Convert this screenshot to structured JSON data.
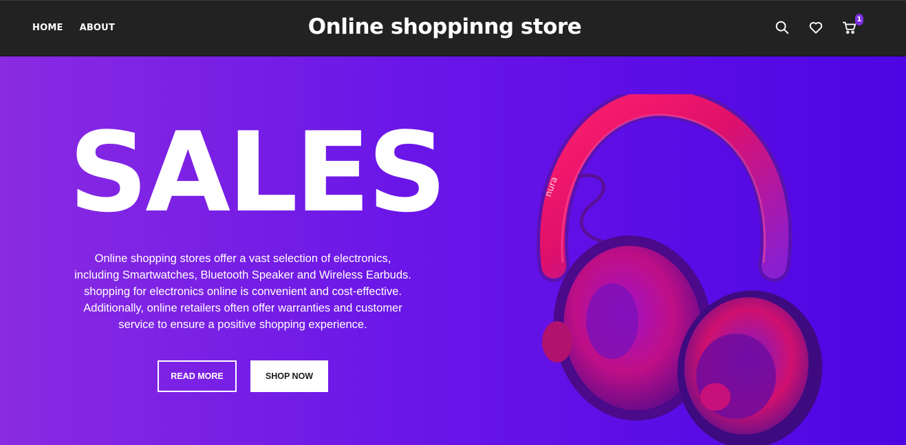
{
  "nav": {
    "links": [
      {
        "label": "HOME"
      },
      {
        "label": "ABOUT"
      }
    ],
    "brand": "Online shoppinng store",
    "icons": [
      "search-icon",
      "heart-icon",
      "cart-icon"
    ],
    "cart_count": "1"
  },
  "hero": {
    "title": "SALES",
    "description": "Online shopping stores offer a vast selection of electronics, including Smartwatches, Bluetooth Speaker and Wireless Earbuds. shopping for electronics online is convenient and cost-effective. Additionally, online retailers often offer warranties and customer service to ensure a positive shopping experience.",
    "read_more_label": "READ MORE",
    "shop_now_label": "SHOP NOW",
    "product_brand_text": "nura"
  },
  "colors": {
    "navbar_bg": "#222222",
    "hero_gradient_start": "#8a2be2",
    "hero_gradient_end": "#4d05e3",
    "badge": "#7b2fe0",
    "headphone_pink": "#e8106a"
  }
}
